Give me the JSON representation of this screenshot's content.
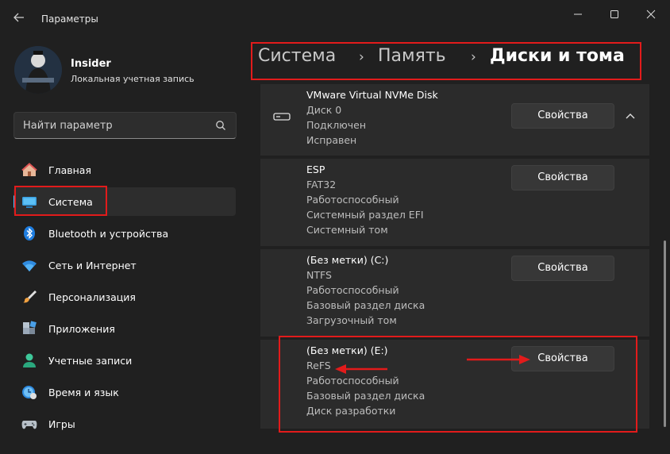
{
  "window": {
    "title": "Параметры",
    "back_icon": "back-arrow-icon",
    "controls": [
      "minimize-icon",
      "maximize-icon",
      "close-icon"
    ]
  },
  "profile": {
    "name": "Insider",
    "account_type": "Локальная учетная запись"
  },
  "search": {
    "placeholder": "Найти параметр",
    "icon": "search-icon"
  },
  "nav": {
    "items": [
      {
        "label": "Главная",
        "icon": "home-icon"
      },
      {
        "label": "Система",
        "icon": "system-display-icon",
        "selected": true
      },
      {
        "label": "Bluetooth и устройства",
        "icon": "bluetooth-icon"
      },
      {
        "label": "Сеть и Интернет",
        "icon": "wifi-icon"
      },
      {
        "label": "Персонализация",
        "icon": "brush-icon"
      },
      {
        "label": "Приложения",
        "icon": "apps-icon"
      },
      {
        "label": "Учетные записи",
        "icon": "accounts-icon"
      },
      {
        "label": "Время и язык",
        "icon": "time-language-icon"
      },
      {
        "label": "Игры",
        "icon": "gamepad-icon"
      }
    ]
  },
  "breadcrumb": {
    "items": [
      "Система",
      "Память",
      "Диски и тома"
    ],
    "separator": "›"
  },
  "disk": {
    "name": "VMware Virtual NVMe Disk",
    "lines": [
      "Диск 0",
      "Подключен",
      "Исправен"
    ],
    "button": "Свойства",
    "expand_icon": "chevron-up-icon"
  },
  "volumes": [
    {
      "lines": [
        "ESP",
        "FAT32",
        "Работоспособный",
        "Системный раздел EFI",
        "Системный том"
      ],
      "button": "Свойства"
    },
    {
      "lines": [
        "(Без метки) (C:)",
        "NTFS",
        "Работоспособный",
        "Базовый раздел диска",
        "Загрузочный том"
      ],
      "button": "Свойства"
    },
    {
      "lines": [
        "(Без метки) (E:)",
        "ReFS",
        "Работоспособный",
        "Базовый раздел диска",
        "Диск разработки"
      ],
      "button": "Свойства",
      "highlighted": true
    }
  ],
  "colors": {
    "background": "#202020",
    "card": "#2b2b2b",
    "accent": "#4cc2ff",
    "annotation": "#e21b1b"
  }
}
